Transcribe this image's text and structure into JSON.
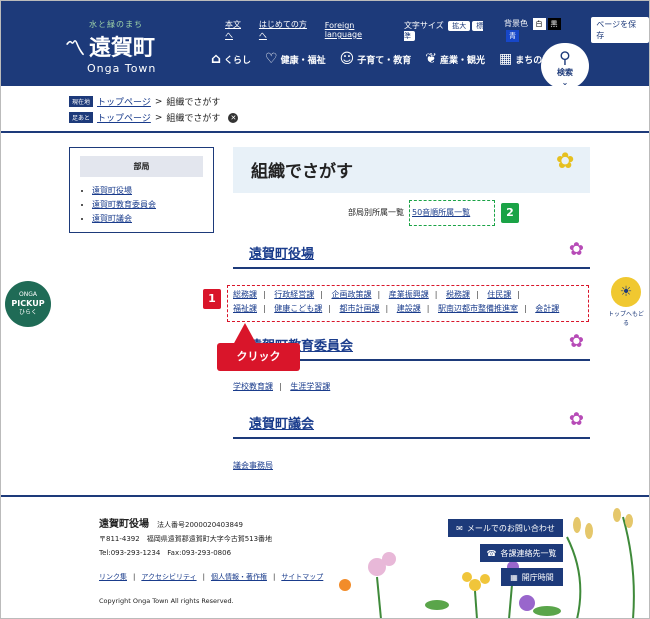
{
  "header": {
    "logo_tagline": "水と緑のまち",
    "logo_name": "遠賀町",
    "logo_en": "Onga Town",
    "links": [
      "本文へ",
      "はじめての方へ",
      "Foreign language"
    ],
    "font_size_label": "文字サイズ",
    "font_large": "拡大",
    "font_standard": "標準",
    "bg_label": "背景色",
    "bg_white": "白",
    "bg_black": "黒",
    "bg_blue": "青",
    "save_label": "ページを保存",
    "nav": [
      "くらし",
      "健康・福祉",
      "子育て・教育",
      "産業・観光",
      "まちの情報"
    ],
    "search_label": "検索"
  },
  "breadcrumb": {
    "current_tag": "現在地",
    "home": "トップページ",
    "sep": ">",
    "current": "組織でさがす",
    "footprint_tag": "足あと"
  },
  "side": {
    "heading": "部局",
    "items": [
      "遠賀町役場",
      "遠賀町教育委員会",
      "遠賀町議会"
    ]
  },
  "main": {
    "title": "組織でさがす",
    "list_label": "部局別所属一覧",
    "list_link": "50音順所属一覧",
    "sections": [
      {
        "title": "遠賀町役場",
        "row1": [
          "総務課",
          "行政経営課",
          "企画政策課",
          "産業振興課",
          "税務課",
          "住民課"
        ],
        "row2": [
          "福祉課",
          "健康こども課",
          "都市計画課",
          "建設課",
          "駅南辺都市整備推進室",
          "会計課"
        ]
      },
      {
        "title": "遠賀町教育委員会",
        "row1": [
          "学校教育課",
          "生涯学習課"
        ]
      },
      {
        "title": "遠賀町議会",
        "row1": [
          "議会事務局"
        ]
      }
    ]
  },
  "annotations": {
    "badge1": "1",
    "badge2": "2",
    "click": "クリック",
    "red": "#d9152a",
    "green": "#1aa346"
  },
  "floaters": {
    "pickup_top": "ONGA",
    "pickup_main": "PICKUP",
    "pickup_sub": "ひらく",
    "totop": "トップへもどる"
  },
  "footer": {
    "name": "遠賀町役場",
    "corp": "法人番号2000020403849",
    "address": "〒811-4392　福岡県遠賀郡遠賀町大字今古賀513番地",
    "tel": "Tel:093-293-1234　Fax:093-293-0806",
    "links": [
      "リンク集",
      "アクセシビリティ",
      "個人情報・著作権",
      "サイトマップ"
    ],
    "copyright": "Copyright Onga Town All rights Reserved.",
    "btn_mail": "メールでのお問い合わせ",
    "btn_contacts": "各課連絡先一覧",
    "btn_hours": "開庁時間"
  },
  "colors": {
    "navy": "#1d3a7a"
  }
}
